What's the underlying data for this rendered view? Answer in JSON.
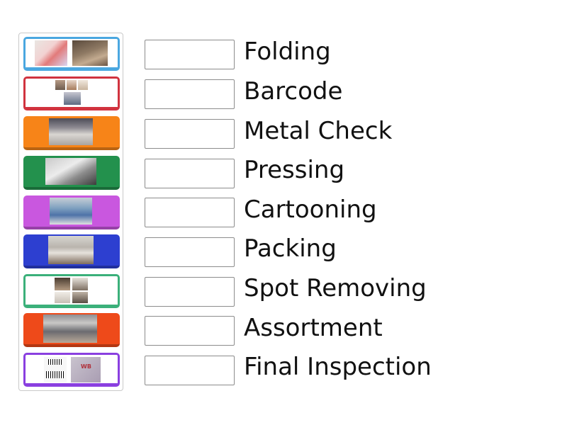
{
  "labels": [
    "Folding",
    "Barcode",
    "Metal Check",
    "Pressing",
    "Cartooning",
    "Packing",
    "Spot Removing",
    "Assortment",
    "Final Inspection"
  ],
  "tiles": [
    {
      "name": "tile-1",
      "color": "#4aa7e0",
      "style": "filled-white"
    },
    {
      "name": "tile-2",
      "color": "#d1333f",
      "style": "outlined"
    },
    {
      "name": "tile-3",
      "color": "#f78418",
      "style": "filled"
    },
    {
      "name": "tile-4",
      "color": "#23914d",
      "style": "filled"
    },
    {
      "name": "tile-5",
      "color": "#c957df",
      "style": "filled"
    },
    {
      "name": "tile-6",
      "color": "#2d3fd0",
      "style": "filled"
    },
    {
      "name": "tile-7",
      "color": "#3bb07a",
      "style": "outlined"
    },
    {
      "name": "tile-8",
      "color": "#ee4a1a",
      "style": "filled"
    },
    {
      "name": "tile-9",
      "color": "#8a3fe0",
      "style": "outlined"
    }
  ],
  "barcode_text": "WB"
}
